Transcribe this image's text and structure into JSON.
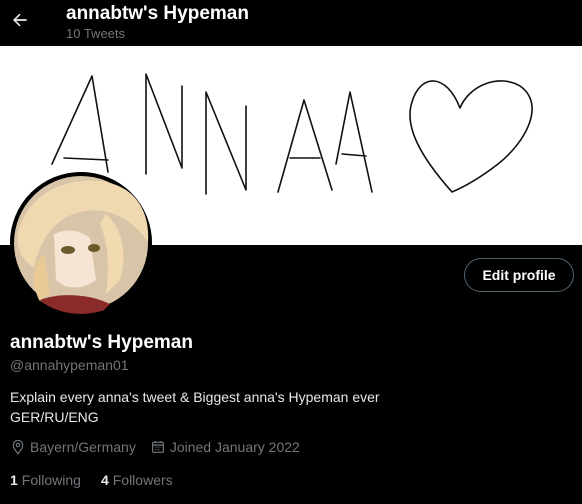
{
  "header": {
    "title": "annabtw's Hypeman",
    "tweet_count": "10 Tweets",
    "back_icon": "arrow-left-icon"
  },
  "banner": {
    "drawing_text": "ANNA",
    "heart_icon": "heart-drawing",
    "background": "#ffffff"
  },
  "profile": {
    "name": "annabtw's Hypeman",
    "handle": "@annahypeman01",
    "bio_line1": "Explain every anna's tweet & Biggest anna's Hypeman ever",
    "bio_line2": "GER/RU/ENG",
    "location": "Bayern/Germany",
    "joined": "Joined January 2022",
    "location_icon": "location-pin-icon",
    "calendar_icon": "calendar-icon"
  },
  "actions": {
    "edit_profile_label": "Edit profile"
  },
  "stats": {
    "following_count": "1",
    "following_label": "Following",
    "followers_count": "4",
    "followers_label": "Followers"
  },
  "colors": {
    "background": "#000000",
    "text_primary": "#e7e9ea",
    "text_secondary": "#71767b",
    "border": "#536471"
  }
}
